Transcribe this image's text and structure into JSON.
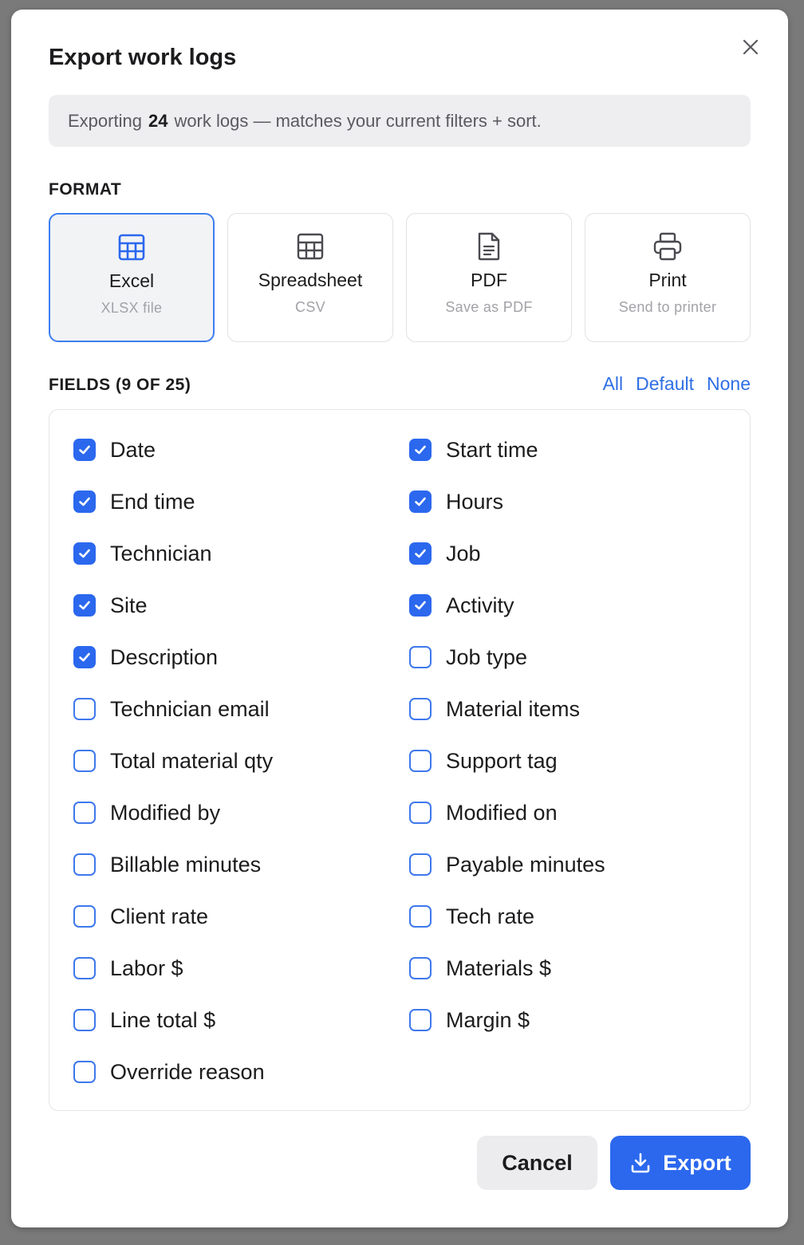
{
  "dialog": {
    "title": "Export work logs",
    "close_icon": "close-icon",
    "banner": {
      "prefix": "Exporting",
      "count": "24",
      "suffix": "work logs — matches your current filters + sort."
    }
  },
  "format": {
    "label": "FORMAT",
    "options": [
      {
        "name": "Excel",
        "sub": "XLSX file",
        "icon": "grid-icon",
        "selected": true
      },
      {
        "name": "Spreadsheet",
        "sub": "CSV",
        "icon": "table-icon",
        "selected": false
      },
      {
        "name": "PDF",
        "sub": "Save as PDF",
        "icon": "document-icon",
        "selected": false
      },
      {
        "name": "Print",
        "sub": "Send to printer",
        "icon": "printer-icon",
        "selected": false
      }
    ]
  },
  "fields": {
    "label": "FIELDS (9 OF 25)",
    "links": {
      "all": "All",
      "default": "Default",
      "none": "None"
    },
    "items": [
      {
        "label": "Date",
        "checked": true
      },
      {
        "label": "Start time",
        "checked": true
      },
      {
        "label": "End time",
        "checked": true
      },
      {
        "label": "Hours",
        "checked": true
      },
      {
        "label": "Technician",
        "checked": true
      },
      {
        "label": "Job",
        "checked": true
      },
      {
        "label": "Site",
        "checked": true
      },
      {
        "label": "Activity",
        "checked": true
      },
      {
        "label": "Description",
        "checked": true
      },
      {
        "label": "Job type",
        "checked": false
      },
      {
        "label": "Technician email",
        "checked": false
      },
      {
        "label": "Material items",
        "checked": false
      },
      {
        "label": "Total material qty",
        "checked": false
      },
      {
        "label": "Support tag",
        "checked": false
      },
      {
        "label": "Modified by",
        "checked": false
      },
      {
        "label": "Modified on",
        "checked": false
      },
      {
        "label": "Billable minutes",
        "checked": false
      },
      {
        "label": "Payable minutes",
        "checked": false
      },
      {
        "label": "Client rate",
        "checked": false
      },
      {
        "label": "Tech rate",
        "checked": false
      },
      {
        "label": "Labor $",
        "checked": false
      },
      {
        "label": "Materials $",
        "checked": false
      },
      {
        "label": "Line total $",
        "checked": false
      },
      {
        "label": "Margin $",
        "checked": false
      },
      {
        "label": "Override reason",
        "checked": false
      }
    ]
  },
  "footer": {
    "cancel_label": "Cancel",
    "export_label": "Export",
    "export_icon": "download-icon"
  },
  "colors": {
    "accent": "#2b68ee",
    "link": "#2f6fe4",
    "selected_border": "#3d7ef0"
  }
}
